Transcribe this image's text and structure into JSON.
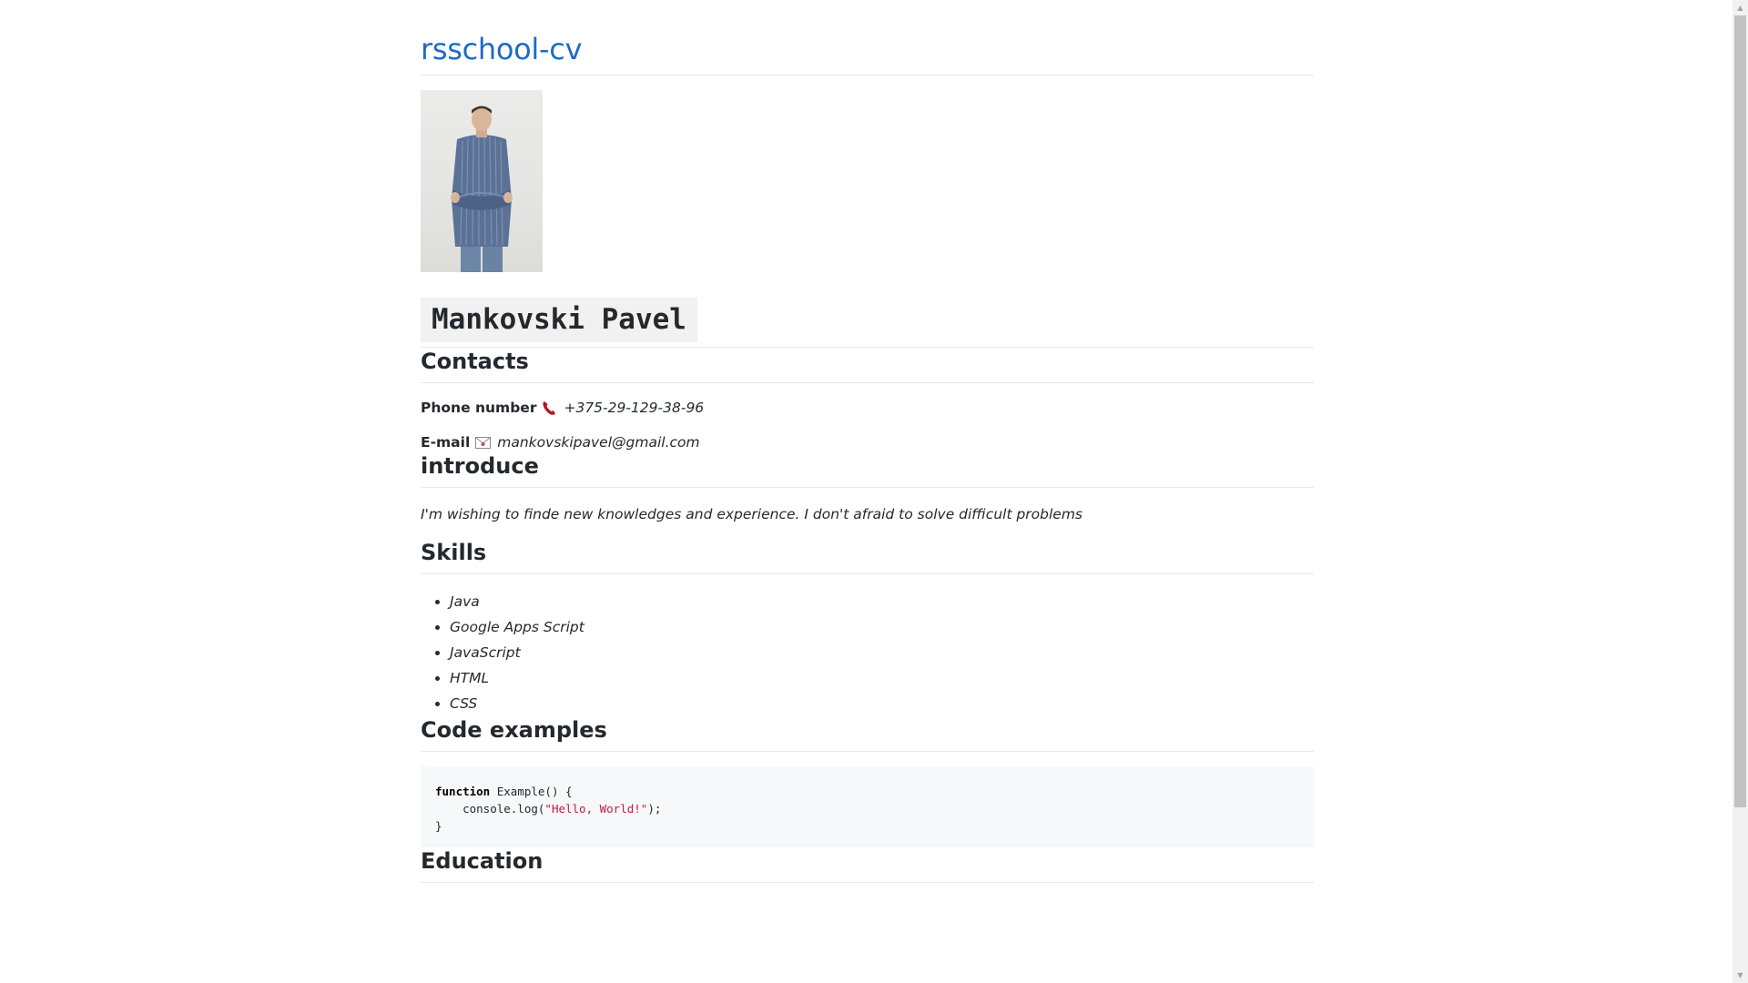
{
  "site": {
    "title": "rsschool-cv"
  },
  "profile": {
    "name": "Mankovski Pavel",
    "photo_icon": "person-photo-icon"
  },
  "contacts": {
    "heading": "Contacts",
    "phone_label": "Phone number",
    "phone_value": "+375-29-129-38-96",
    "email_label": "E-mail",
    "email_value": "mankovskipavel@gmail.com"
  },
  "introduce": {
    "heading": "introduce",
    "text": "I'm wishing to finde new knowledges and experience. I don't afraid to solve difficult problems"
  },
  "skills": {
    "heading": "Skills",
    "items": [
      "Java",
      "Google Apps Script",
      "JavaScript",
      "HTML",
      "CSS"
    ]
  },
  "code_examples": {
    "heading": "Code examples",
    "keyword": "function",
    "fn_rest": " Example() {",
    "line2_pre": "    console.log(",
    "line2_str": "\"Hello, World!\"",
    "line2_post": ");",
    "line3": "}"
  },
  "education": {
    "heading": "Education"
  }
}
